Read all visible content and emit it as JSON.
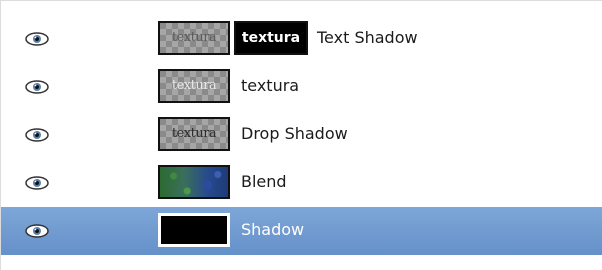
{
  "layers": [
    {
      "name": "Text Shadow",
      "thumb_text": "textura",
      "preview_text": "textura",
      "visible": true
    },
    {
      "name": "textura",
      "thumb_text": "textura",
      "visible": true
    },
    {
      "name": "Drop Shadow",
      "thumb_text": "textura",
      "visible": true
    },
    {
      "name": "Blend",
      "visible": true
    },
    {
      "name": "Shadow",
      "visible": true,
      "selected": true
    }
  ],
  "colors": {
    "selection": "#6f9bd1",
    "background": "#ffffff",
    "text": "#1b1b1b"
  },
  "icons": {
    "visibility": "eye-icon"
  }
}
